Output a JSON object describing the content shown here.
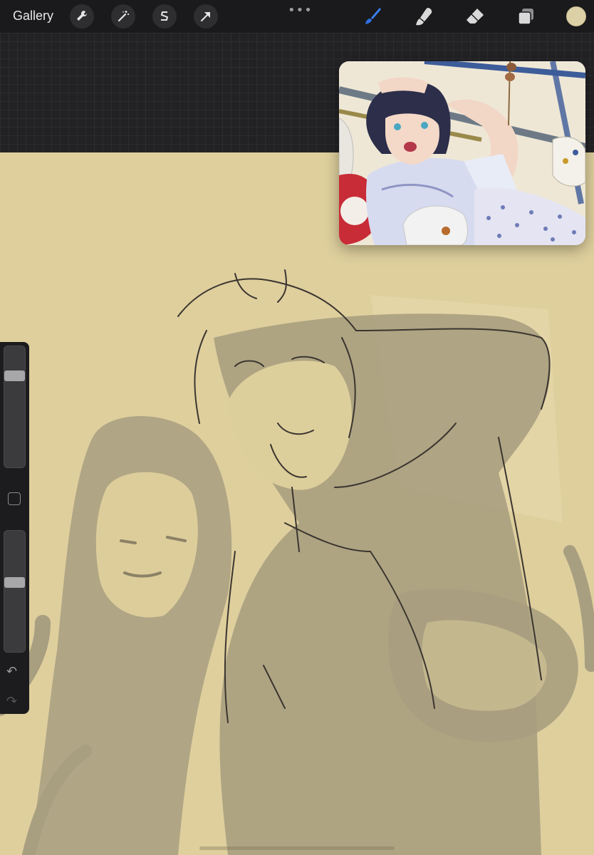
{
  "toolbar": {
    "gallery_label": "Gallery",
    "left_tools": [
      "wrench-icon",
      "magic-wand-icon",
      "selection-s-icon",
      "transform-arrow-icon"
    ],
    "more_label": "•••",
    "right_tools": [
      "brush-icon",
      "smudge-icon",
      "eraser-icon",
      "layers-icon"
    ],
    "active_tool": "brush-icon",
    "current_color": "#dcd0a6",
    "brush_accent": "#2f6fe0"
  },
  "sidebar": {
    "brush_size_level": 0.78,
    "opacity_level": 0.58,
    "undo_label": "↶",
    "redo_label": "↷"
  },
  "canvas": {
    "paper_color": "#decf9d",
    "sketch_fill_color": "#a89e80",
    "line_color": "#3b3530"
  }
}
